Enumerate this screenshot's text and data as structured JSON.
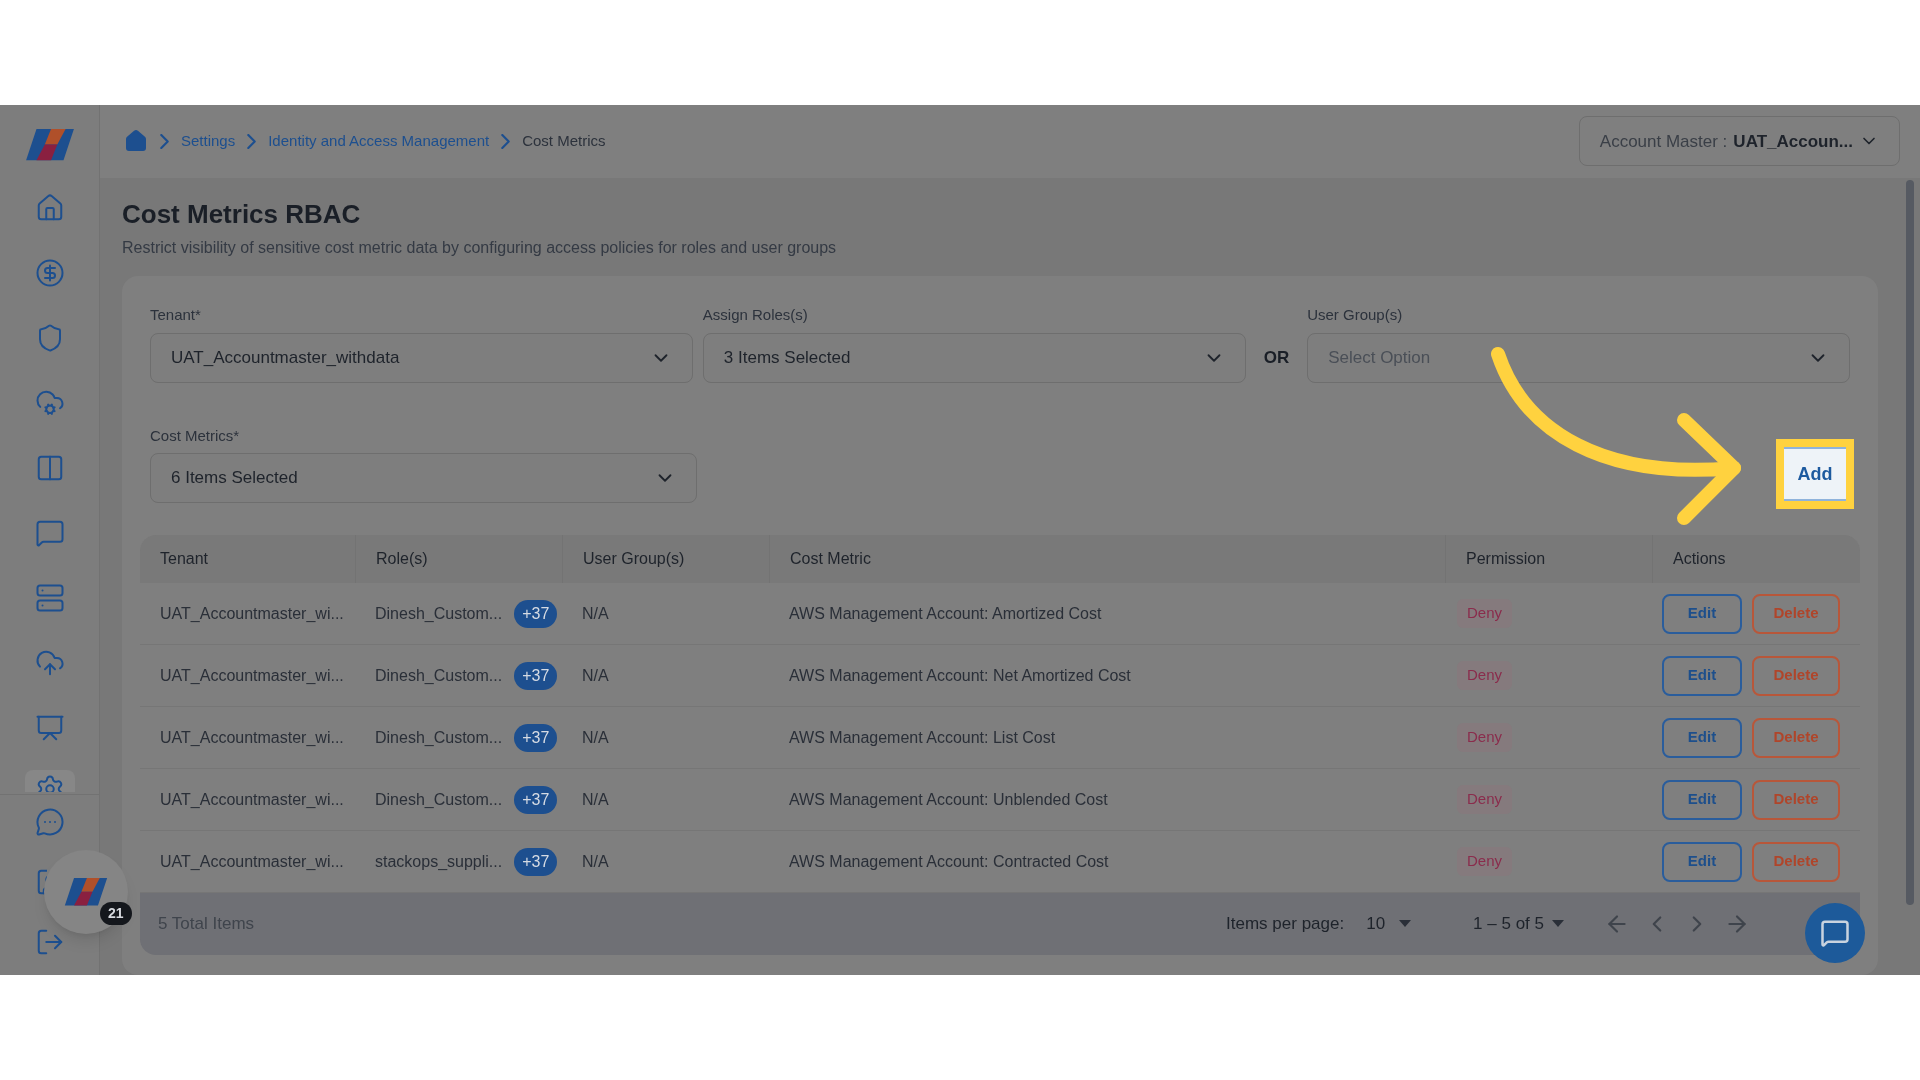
{
  "sidebar": {
    "items": [
      {
        "selected": false
      },
      {
        "selected": false
      },
      {
        "selected": false
      },
      {
        "selected": false
      },
      {
        "selected": false
      },
      {
        "selected": false
      },
      {
        "selected": false
      },
      {
        "selected": false
      },
      {
        "selected": false
      },
      {
        "selected": true
      }
    ]
  },
  "breadcrumb": [
    {
      "label": "Settings",
      "kind": "link"
    },
    {
      "label": "Identity and Access Management",
      "kind": "link"
    },
    {
      "label": "Cost Metrics",
      "kind": "current"
    }
  ],
  "account_selector": {
    "label": "Account Master :",
    "value": "UAT_Accoun..."
  },
  "title": "Cost Metrics RBAC",
  "subtitle": "Restrict visibility of sensitive cost metric data by configuring access policies for roles and user groups",
  "form": {
    "tenant": {
      "label": "Tenant*",
      "value": "UAT_Accountmaster_withdata"
    },
    "roles": {
      "label": "Assign Roles(s)",
      "value": "3 Items Selected"
    },
    "separator": "OR",
    "user_groups": {
      "label": "User Group(s)",
      "placeholder": "Select Option"
    },
    "cost_metrics": {
      "label": "Cost Metrics*",
      "value": "6 Items Selected"
    },
    "add_button": "Add"
  },
  "table": {
    "columns": [
      "Tenant",
      "Role(s)",
      "User Group(s)",
      "Cost Metric",
      "Permission",
      "Actions"
    ],
    "rows": [
      {
        "tenant": "UAT_Accountmaster_wi...",
        "role": "Dinesh_Custom...",
        "role_extra": "+37",
        "user_group": "N/A",
        "cost_metric": "AWS Management Account: Amortized Cost",
        "permission": "Deny",
        "actions": [
          "Edit",
          "Delete"
        ]
      },
      {
        "tenant": "UAT_Accountmaster_wi...",
        "role": "Dinesh_Custom...",
        "role_extra": "+37",
        "user_group": "N/A",
        "cost_metric": "AWS Management Account: Net Amortized Cost",
        "permission": "Deny",
        "actions": [
          "Edit",
          "Delete"
        ]
      },
      {
        "tenant": "UAT_Accountmaster_wi...",
        "role": "Dinesh_Custom...",
        "role_extra": "+37",
        "user_group": "N/A",
        "cost_metric": "AWS Management Account: List Cost",
        "permission": "Deny",
        "actions": [
          "Edit",
          "Delete"
        ]
      },
      {
        "tenant": "UAT_Accountmaster_wi...",
        "role": "Dinesh_Custom...",
        "role_extra": "+37",
        "user_group": "N/A",
        "cost_metric": "AWS Management Account: Unblended Cost",
        "permission": "Deny",
        "actions": [
          "Edit",
          "Delete"
        ]
      },
      {
        "tenant": "UAT_Accountmaster_wi...",
        "role": "stackops_suppli...",
        "role_extra": "+37",
        "user_group": "N/A",
        "cost_metric": "AWS Management Account: Contracted Cost",
        "permission": "Deny",
        "actions": [
          "Edit",
          "Delete"
        ]
      }
    ]
  },
  "footer": {
    "total": "5 Total Items",
    "items_per_page_label": "Items per page:",
    "items_per_page": "10",
    "range": "1 – 5 of 5"
  },
  "notification_count": "21"
}
